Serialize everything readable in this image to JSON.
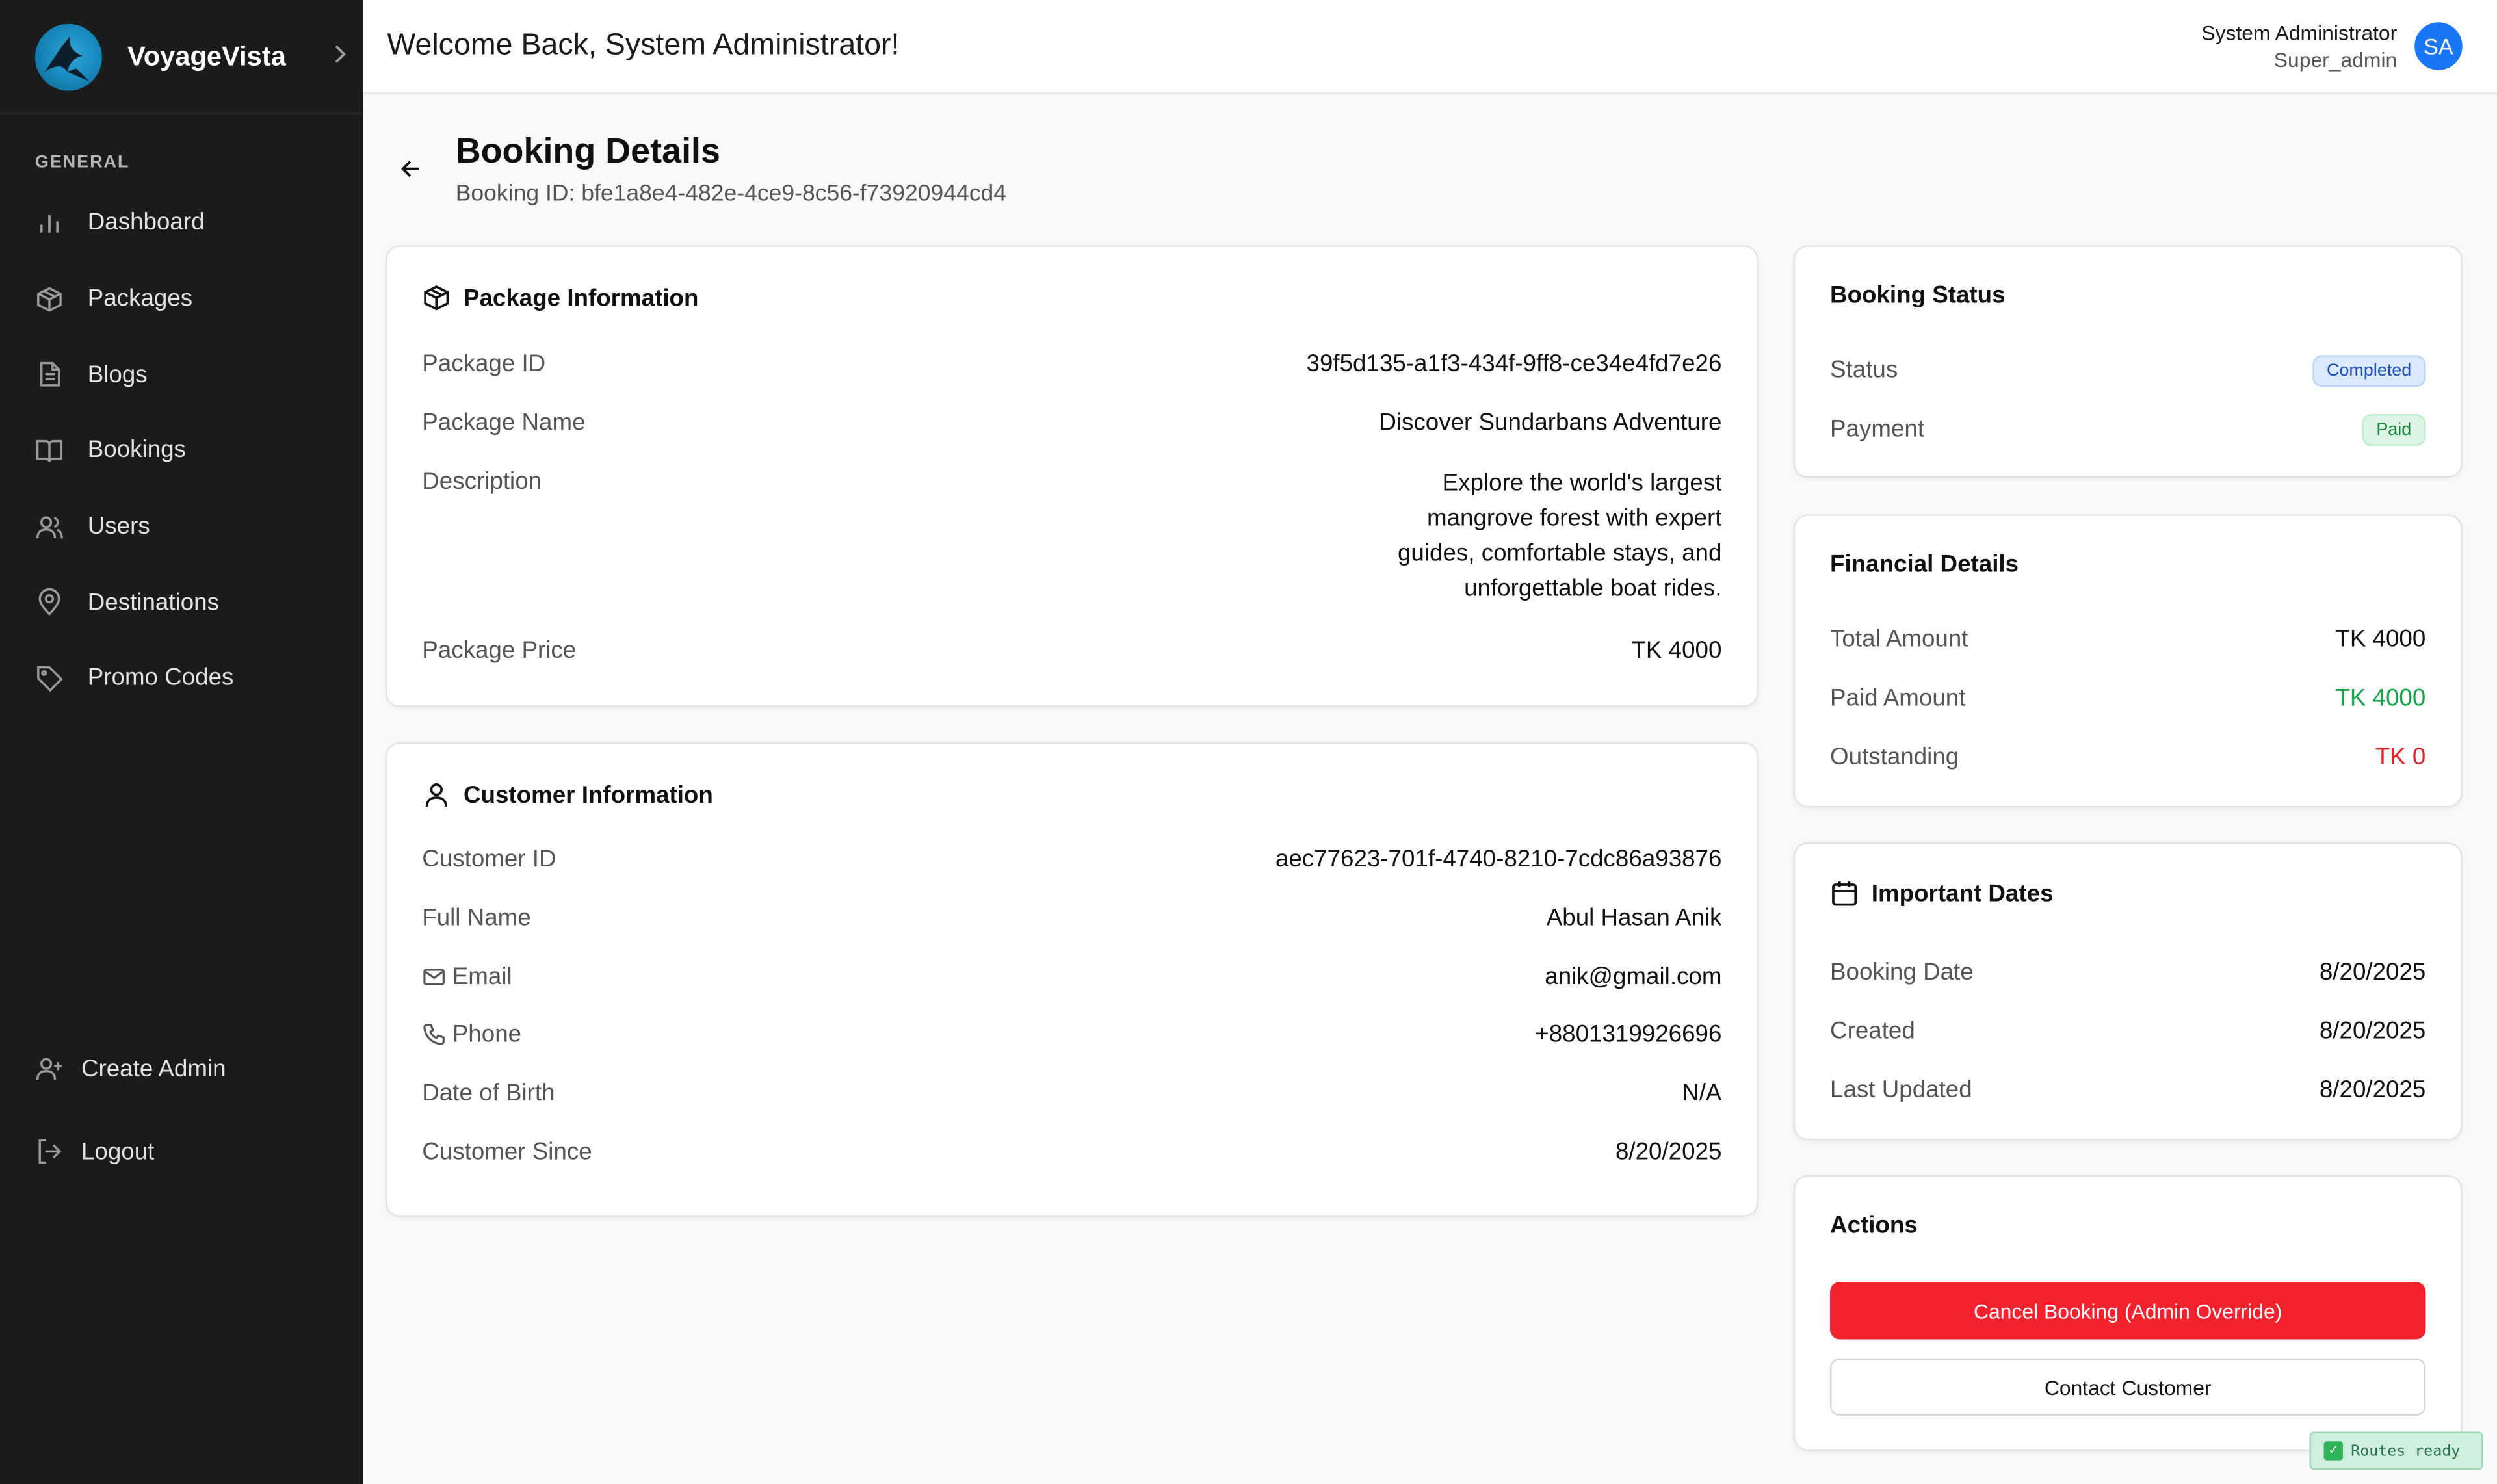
{
  "brand": {
    "name": "VoyageVista"
  },
  "sidebar": {
    "section_label": "GENERAL",
    "items": [
      {
        "label": "Dashboard",
        "icon": "bar-chart-icon"
      },
      {
        "label": "Packages",
        "icon": "package-icon"
      },
      {
        "label": "Blogs",
        "icon": "file-text-icon"
      },
      {
        "label": "Bookings",
        "icon": "book-open-icon"
      },
      {
        "label": "Users",
        "icon": "users-icon"
      },
      {
        "label": "Destinations",
        "icon": "map-pin-icon"
      },
      {
        "label": "Promo Codes",
        "icon": "tag-icon"
      }
    ],
    "bottom": [
      {
        "label": "Create Admin",
        "icon": "user-plus-icon"
      },
      {
        "label": "Logout",
        "icon": "logout-icon"
      }
    ]
  },
  "header": {
    "welcome": "Welcome Back, System Administrator!",
    "user_name": "System Administrator",
    "user_role": "Super_admin",
    "avatar_initials": "SA"
  },
  "page": {
    "title": "Booking Details",
    "subtitle": "Booking ID: bfe1a8e4-482e-4ce9-8c56-f73920944cd4"
  },
  "package": {
    "title": "Package Information",
    "rows": [
      {
        "label": "Package ID",
        "value": "39f5d135-a1f3-434f-9ff8-ce34e4fd7e26"
      },
      {
        "label": "Package Name",
        "value": "Discover Sundarbans Adventure"
      },
      {
        "label": "Description",
        "value": "Explore the world's largest mangrove forest with expert guides, comfortable stays, and unforgettable boat rides."
      },
      {
        "label": "Package Price",
        "value": "TK 4000"
      }
    ]
  },
  "customer": {
    "title": "Customer Information",
    "rows": [
      {
        "label": "Customer ID",
        "value": "aec77623-701f-4740-8210-7cdc86a93876"
      },
      {
        "label": "Full Name",
        "value": "Abul Hasan Anik"
      },
      {
        "label": "Email",
        "value": "anik@gmail.com"
      },
      {
        "label": "Phone",
        "value": "+8801319926696"
      },
      {
        "label": "Date of Birth",
        "value": "N/A"
      },
      {
        "label": "Customer Since",
        "value": "8/20/2025"
      }
    ]
  },
  "status": {
    "title": "Booking Status",
    "status_label": "Status",
    "status_value": "Completed",
    "payment_label": "Payment",
    "payment_value": "Paid"
  },
  "financial": {
    "title": "Financial Details",
    "total_label": "Total Amount",
    "total_value": "TK 4000",
    "paid_label": "Paid Amount",
    "paid_value": "TK 4000",
    "outstanding_label": "Outstanding",
    "outstanding_value": "TK 0"
  },
  "dates": {
    "title": "Important Dates",
    "rows": [
      {
        "label": "Booking Date",
        "value": "8/20/2025"
      },
      {
        "label": "Created",
        "value": "8/20/2025"
      },
      {
        "label": "Last Updated",
        "value": "8/20/2025"
      }
    ]
  },
  "actions": {
    "title": "Actions",
    "cancel_label": "Cancel Booking (Admin Override)",
    "contact_label": "Contact Customer"
  },
  "toast": {
    "text": "Routes ready"
  },
  "colors": {
    "sidebar_bg": "#1b1b1b",
    "accent_blue": "#1976f5",
    "danger": "#f5222d",
    "success": "#16a34a",
    "error": "#e5202b"
  }
}
